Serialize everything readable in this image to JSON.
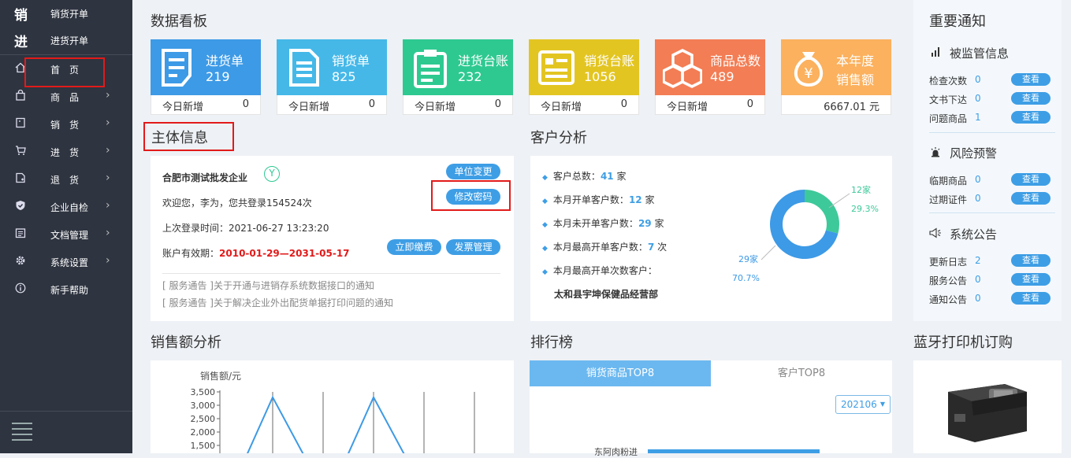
{
  "sidebar": {
    "quick": [
      {
        "icon_char": "销",
        "label": "销货开单"
      },
      {
        "icon_char": "进",
        "label": "进货开单"
      }
    ],
    "items": [
      {
        "icon": "home-icon",
        "label": "首　页",
        "has_chevron": false
      },
      {
        "icon": "bag-icon",
        "label": "商　品",
        "has_chevron": true
      },
      {
        "icon": "sales-doc-icon",
        "label": "销　货",
        "has_chevron": true
      },
      {
        "icon": "cart-icon",
        "label": "进　货",
        "has_chevron": true
      },
      {
        "icon": "return-doc-icon",
        "label": "退　货",
        "has_chevron": true
      },
      {
        "icon": "shield-icon",
        "label": "企业自检",
        "has_chevron": true
      },
      {
        "icon": "archive-icon",
        "label": "文档管理",
        "has_chevron": true
      },
      {
        "icon": "gear-icon",
        "label": "系统设置",
        "has_chevron": true
      },
      {
        "icon": "info-icon",
        "label": "新手帮助",
        "has_chevron": false
      }
    ],
    "bottom_icon": "menu-icon"
  },
  "dashboard": {
    "title": "数据看板",
    "cards": [
      {
        "label": "进货单",
        "value": "219",
        "footer_label": "今日新增",
        "footer_value": "0",
        "color": "#3d9ae6",
        "icon": "purchase-order-icon"
      },
      {
        "label": "销货单",
        "value": "825",
        "footer_label": "今日新增",
        "footer_value": "0",
        "color": "#45b8e8",
        "icon": "sales-order-icon"
      },
      {
        "label": "进货台账",
        "value": "232",
        "footer_label": "今日新增",
        "footer_value": "0",
        "color": "#2ec991",
        "icon": "clipboard-icon"
      },
      {
        "label": "销货台账",
        "value": "1056",
        "footer_label": "今日新增",
        "footer_value": "0",
        "color": "#e3c522",
        "icon": "ledger-icon"
      },
      {
        "label": "商品总数",
        "value": "489",
        "footer_label": "今日新增",
        "footer_value": "0",
        "color": "#f37d54",
        "icon": "boxes-icon"
      },
      {
        "label": "本年度",
        "value": "销售额",
        "footer_label": "",
        "footer_value": "6667.01 元",
        "color": "#fbb15e",
        "icon": "money-bag-icon"
      }
    ]
  },
  "entity": {
    "title": "主体信息",
    "company": "合肥市测试批发企业",
    "badge": "Y",
    "welcome": "欢迎您，李为，您共登录154524次",
    "last_login": "上次登录时间：2021-06-27 13:23:20",
    "validity_label": "账户有效期：",
    "validity_value": "2010-01-29—2031-05-17",
    "btn_change_unit": "单位变更",
    "btn_change_password": "修改密码",
    "btn_pay": "立即缴费",
    "btn_invoice": "发票管理",
    "notices": [
      "[ 服务通告 ]关于开通与进销存系统数据接口的通知",
      "[ 服务通告 ]关于解决企业外出配货单据打印问题的通知"
    ]
  },
  "customer": {
    "title": "客户分析",
    "rows": [
      {
        "pre": "客户总数：",
        "num": "41",
        "post": " 家"
      },
      {
        "pre": "本月开单客户数：",
        "num": "12",
        "post": " 家"
      },
      {
        "pre": "本月未开单客户数：",
        "num": "29",
        "post": " 家"
      },
      {
        "pre": "本月最高开单客户数：",
        "num": "7",
        "post": " 次"
      },
      {
        "pre": "本月最高开单次数客户：",
        "num": "",
        "post": ""
      }
    ],
    "top_customer": "太和县宇坤保健品经营部",
    "chart_data": {
      "type": "pie",
      "donut": true,
      "slices": [
        {
          "label": "12家",
          "value": 12,
          "percent": "29.3%",
          "color": "#3ec99a"
        },
        {
          "label": "29家",
          "value": 29,
          "percent": "70.7%",
          "color": "#3d9ae6"
        }
      ]
    }
  },
  "sales_analysis": {
    "title": "销售额分析",
    "chart_data": {
      "type": "line",
      "ylabel": "销售额/元",
      "yticks": [
        "3,500",
        "3,000",
        "2,500",
        "2,000",
        "1,500"
      ],
      "ylim": [
        0,
        3500
      ],
      "peaks": [
        3300,
        3300
      ]
    }
  },
  "ranking": {
    "title": "排行榜",
    "tabs": [
      "销货商品TOP8",
      "客户TOP8"
    ],
    "month_select": "202106",
    "first_item": "东阿肉粉进"
  },
  "notices": {
    "title": "重要通知",
    "sections": [
      {
        "icon": "signal-bars-icon",
        "title": "被监管信息",
        "rows": [
          {
            "label": "检查次数",
            "value": "0",
            "btn": "查看"
          },
          {
            "label": "文书下达",
            "value": "0",
            "btn": "查看"
          },
          {
            "label": "问题商品",
            "value": "1",
            "btn": "查看"
          }
        ]
      },
      {
        "icon": "alarm-light-icon",
        "title": "风险预警",
        "rows": [
          {
            "label": "临期商品",
            "value": "0",
            "btn": "查看"
          },
          {
            "label": "过期证件",
            "value": "0",
            "btn": "查看"
          }
        ]
      },
      {
        "icon": "speaker-icon",
        "title": "系统公告",
        "rows": [
          {
            "label": "更新日志",
            "value": "2",
            "btn": "查看"
          },
          {
            "label": "服务公告",
            "value": "0",
            "btn": "查看"
          },
          {
            "label": "通知公告",
            "value": "0",
            "btn": "查看"
          }
        ]
      }
    ]
  },
  "printer": {
    "title": "蓝牙打印机订购"
  }
}
